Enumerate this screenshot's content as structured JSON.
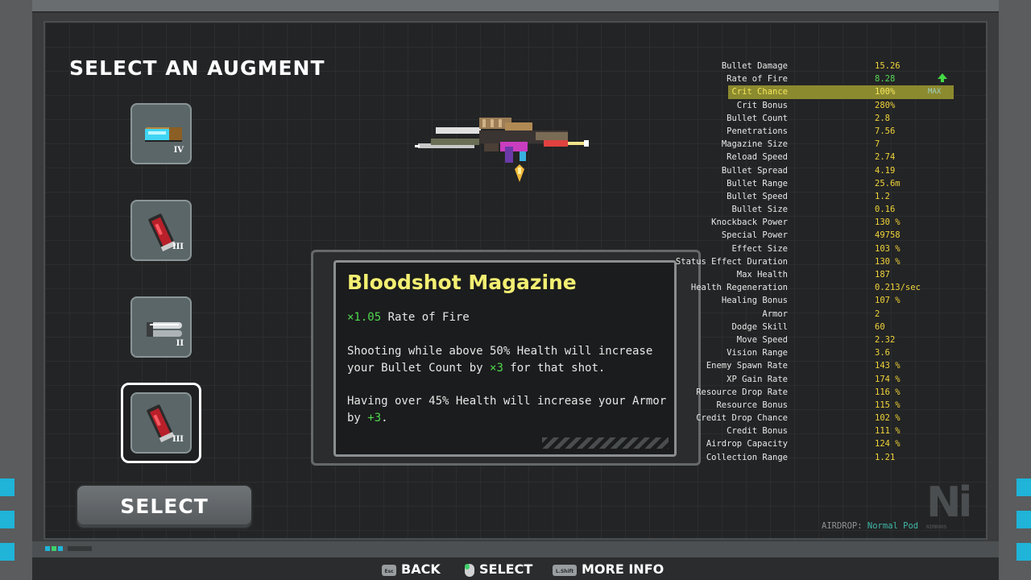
{
  "title": "SELECT AN AUGMENT",
  "augments": [
    {
      "tier": "IV",
      "icon": "cyan-cylinder-augment-icon"
    },
    {
      "tier": "III",
      "icon": "red-magazine-augment-icon"
    },
    {
      "tier": "II",
      "icon": "silver-barrel-augment-icon"
    },
    {
      "tier": "III",
      "icon": "red-magazine-augment-icon",
      "selected": true
    }
  ],
  "select_button": "SELECT",
  "tooltip": {
    "name": "Bloodshot Magazine",
    "modifier_value": "×1.05",
    "modifier_label": "Rate of Fire",
    "desc1_a": "Shooting while above 50% Health will increase your Bullet Count by ",
    "desc1_val": "×3",
    "desc1_b": " for that shot.",
    "desc2_a": "Having over 45% Health will increase your Armor by ",
    "desc2_val": "+3",
    "desc2_b": "."
  },
  "stats": [
    {
      "label": "Bullet Damage",
      "value": "15.26"
    },
    {
      "label": "Rate of Fire",
      "value": "8.28",
      "color": "green",
      "arrow": true
    },
    {
      "label": "Crit Chance",
      "value": "100%",
      "highlight": true,
      "extra": "MAX"
    },
    {
      "label": "Crit Bonus",
      "value": "280%"
    },
    {
      "label": "Bullet Count",
      "value": "2.8"
    },
    {
      "label": "Penetrations",
      "value": "7.56"
    },
    {
      "label": "Magazine Size",
      "value": "7"
    },
    {
      "label": "Reload Speed",
      "value": "2.74"
    },
    {
      "label": "Bullet Spread",
      "value": "4.19"
    },
    {
      "label": "Bullet Range",
      "value": "25.6m"
    },
    {
      "label": "Bullet Speed",
      "value": "1.2"
    },
    {
      "label": "Bullet Size",
      "value": "0.16"
    },
    {
      "label": "Knockback Power",
      "value": "130 %"
    },
    {
      "label": "Special Power",
      "value": "49758"
    },
    {
      "label": "Effect Size",
      "value": "103 %"
    },
    {
      "label": "Status Effect Duration",
      "value": "130 %"
    },
    {
      "label": "Max Health",
      "value": "187"
    },
    {
      "label": "Health Regeneration",
      "value": "0.213/sec"
    },
    {
      "label": "Healing Bonus",
      "value": "107 %"
    },
    {
      "label": "Armor",
      "value": "2"
    },
    {
      "label": "Dodge Skill",
      "value": "60"
    },
    {
      "label": "Move Speed",
      "value": "2.32"
    },
    {
      "label": "Vision Range",
      "value": "3.6"
    },
    {
      "label": "Enemy Spawn Rate",
      "value": "143 %"
    },
    {
      "label": "XP Gain Rate",
      "value": "174 %"
    },
    {
      "label": "Resource Drop Rate",
      "value": "116 %"
    },
    {
      "label": "Resource Bonus",
      "value": "115 %"
    },
    {
      "label": "Credit Drop Chance",
      "value": "102 %"
    },
    {
      "label": "Credit Bonus",
      "value": "111 %"
    },
    {
      "label": "Airdrop Capacity",
      "value": "124 %"
    },
    {
      "label": "Collection Range",
      "value": "1.21"
    }
  ],
  "airdrop_label": "AIRDROP:",
  "airdrop_value": "Normal Pod",
  "logo": "Ni",
  "logo_sub": "NIMROOS",
  "footer": {
    "back": "BACK",
    "back_key": "Esc",
    "select": "SELECT",
    "more_info": "MORE INFO",
    "more_info_key": "L.Shift"
  },
  "colors": {
    "accent_yellow": "#f3ef72",
    "stat_value": "#f1d43a",
    "positive": "#4fd84f",
    "cyan": "#1fb4d8"
  }
}
